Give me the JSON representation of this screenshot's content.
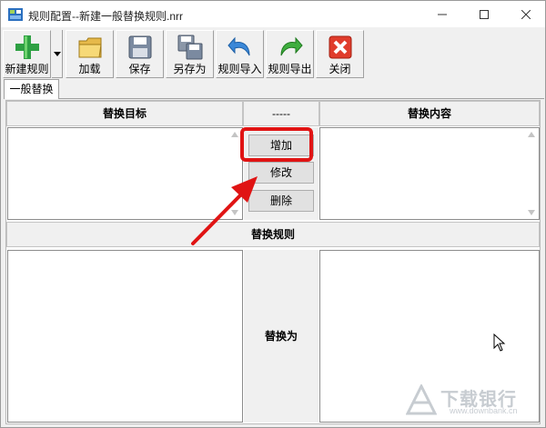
{
  "window": {
    "title": "规则配置--新建一般替换规则.nrr"
  },
  "toolbar": {
    "buttons": [
      {
        "label": "新建规则",
        "icon": "plus-icon"
      },
      {
        "label": "加载",
        "icon": "folder-icon"
      },
      {
        "label": "保存",
        "icon": "floppy-icon"
      },
      {
        "label": "另存为",
        "icon": "save-as-icon"
      },
      {
        "label": "规则导入",
        "icon": "import-icon"
      },
      {
        "label": "规则导出",
        "icon": "export-icon"
      },
      {
        "label": "关闭",
        "icon": "close-red-icon"
      }
    ]
  },
  "tabs": [
    {
      "label": "一般替换"
    }
  ],
  "panel": {
    "header_target": "替换目标",
    "header_mid": "-----",
    "header_content": "替换内容",
    "buttons": {
      "add": "增加",
      "modify": "修改",
      "delete": "删除"
    },
    "rules_header": "替换规则",
    "replace_with": "替换为"
  },
  "watermark": {
    "text": "下载银行",
    "url": "www.downbank.cn"
  },
  "colors": {
    "highlight": "#e01414",
    "accent_green": "#2ea043",
    "close_red": "#e03c2c"
  }
}
